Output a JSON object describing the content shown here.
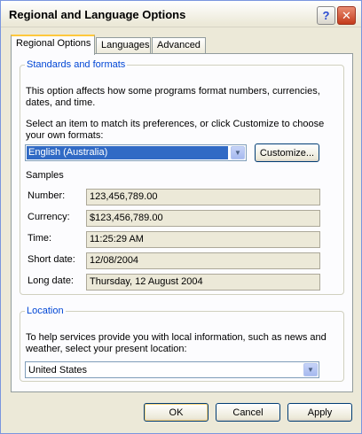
{
  "window": {
    "title": "Regional and Language Options",
    "help_glyph": "?",
    "close_glyph": "✕"
  },
  "tabs": [
    {
      "label": "Regional Options"
    },
    {
      "label": "Languages"
    },
    {
      "label": "Advanced"
    }
  ],
  "standards": {
    "legend": "Standards and formats",
    "description": "This option affects how some programs format numbers, currencies, dates, and time.",
    "instruction": "Select an item to match its preferences, or click Customize to choose your own formats:",
    "selected_format": "English (Australia)",
    "customize_label": "Customize...",
    "samples_heading": "Samples",
    "samples": [
      {
        "label": "Number:",
        "value": "123,456,789.00"
      },
      {
        "label": "Currency:",
        "value": "$123,456,789.00"
      },
      {
        "label": "Time:",
        "value": "11:25:29 AM"
      },
      {
        "label": "Short date:",
        "value": "12/08/2004"
      },
      {
        "label": "Long date:",
        "value": "Thursday, 12 August 2004"
      }
    ]
  },
  "location": {
    "legend": "Location",
    "description": "To help services provide you with local information, such as news and weather, select your present location:",
    "selected": "United States"
  },
  "buttons": {
    "ok": "OK",
    "cancel": "Cancel",
    "apply": "Apply"
  },
  "colors": {
    "legend_text": "#0046d5",
    "selection": "#316ac5",
    "tab_highlight": "#ffc83c"
  }
}
